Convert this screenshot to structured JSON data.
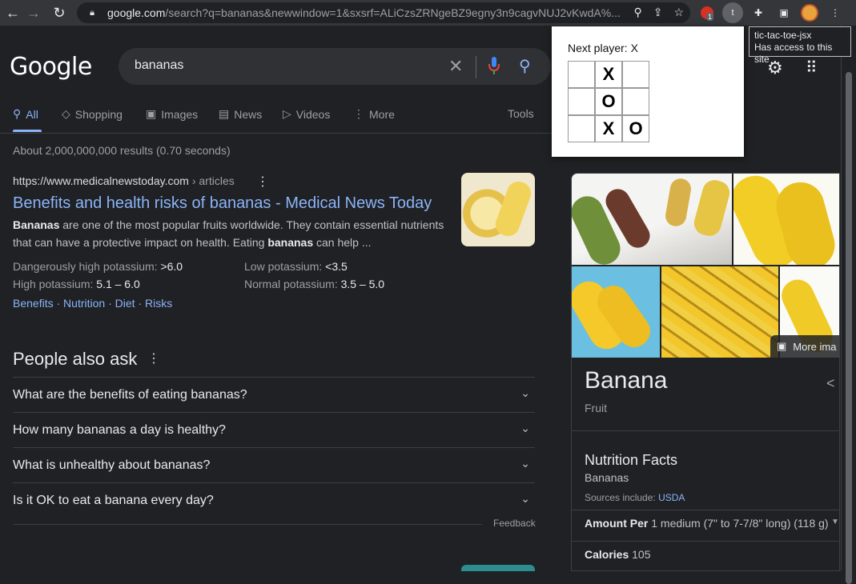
{
  "browser": {
    "url_host": "google.com",
    "url_rest": "/search?q=bananas&newwindow=1&sxsrf=ALiCzsZRNgeBZ9egny3n9cagvNUJ2vKwdA%...",
    "ext_badge": "1",
    "ext_t_label": "t"
  },
  "google": {
    "logo": "Google",
    "query": "bananas",
    "tabs": [
      {
        "label": "All"
      },
      {
        "label": "Shopping"
      },
      {
        "label": "Images"
      },
      {
        "label": "News"
      },
      {
        "label": "Videos"
      },
      {
        "label": "More"
      }
    ],
    "tools": "Tools",
    "stats": "About 2,000,000,000 results (0.70 seconds)"
  },
  "result": {
    "url": "https://www.medicalnewstoday.com",
    "crumb": " › articles",
    "title": "Benefits and health risks of bananas - Medical News Today",
    "snippet_b1": "Bananas",
    "snippet_1": " are one of the most popular fruits worldwide. They contain essential nutrients that can have a protective impact on health. Eating ",
    "snippet_b2": "bananas",
    "snippet_2": " can help ...",
    "facts": [
      {
        "label": "Dangerously high potassium: ",
        "value": ">6.0"
      },
      {
        "label": "High potassium: ",
        "value": "5.1 – 6.0"
      },
      {
        "label": "Low potassium: ",
        "value": "<3.5"
      },
      {
        "label": "Normal potassium: ",
        "value": "3.5 – 5.0"
      }
    ],
    "sitelinks": [
      "Benefits",
      "Nutrition",
      "Diet",
      "Risks"
    ],
    "sitelink_sep": " · "
  },
  "paa": {
    "title": "People also ask",
    "questions": [
      "What are the benefits of eating bananas?",
      "How many bananas a day is healthy?",
      "What is unhealthy about bananas?",
      "Is it OK to eat a banana every day?"
    ],
    "feedback": "Feedback"
  },
  "knowledge": {
    "more_images": "More ima",
    "title": "Banana",
    "subtitle": "Fruit",
    "nutrition_title": "Nutrition Facts",
    "nutrition_sub": "Bananas",
    "sources_label": "Sources include: ",
    "sources_link": "USDA",
    "amount_label": "Amount Per",
    "amount_value": " 1 medium (7\" to 7-7/8\" long) (118 g)",
    "calories_label": "Calories",
    "calories_value": " 105"
  },
  "popup": {
    "status": "Next player: X",
    "board": [
      "",
      "X",
      "",
      "",
      "O",
      "",
      "",
      "X",
      "O"
    ]
  },
  "tooltip": {
    "line1": "tic-tac-toe-jsx",
    "line2": "Has access to this site"
  }
}
